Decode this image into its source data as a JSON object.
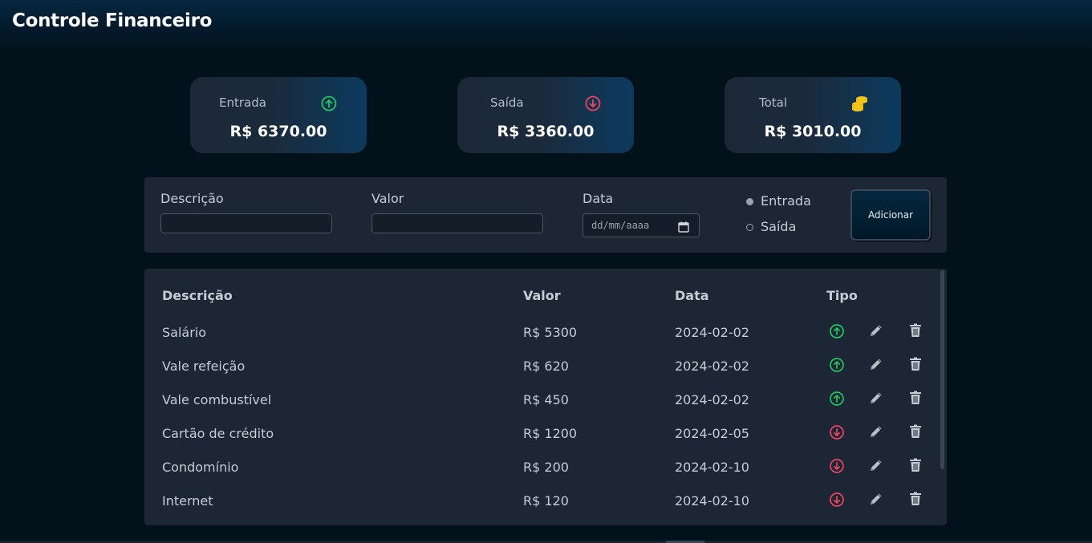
{
  "app": {
    "title": "Controle Financeiro"
  },
  "summary": {
    "income": {
      "label": "Entrada",
      "value": "R$ 6370.00",
      "icon": "arrow-up-circle-icon",
      "color": "#22c55e"
    },
    "expense": {
      "label": "Saída",
      "value": "R$ 3360.00",
      "icon": "arrow-down-circle-icon",
      "color": "#ef4460"
    },
    "total": {
      "label": "Total",
      "value": "R$ 3010.00",
      "icon": "coins-icon",
      "color": "#f5c518"
    }
  },
  "form": {
    "description_label": "Descrição",
    "description_value": "",
    "amount_label": "Valor",
    "amount_value": "",
    "date_label": "Data",
    "date_placeholder": "dd/mm/aaaa",
    "type_options": [
      {
        "label": "Entrada",
        "checked": true
      },
      {
        "label": "Saída",
        "checked": false
      }
    ],
    "add_button": "Adicionar"
  },
  "table": {
    "headers": {
      "description": "Descrição",
      "amount": "Valor",
      "date": "Data",
      "type": "Tipo"
    },
    "rows": [
      {
        "description": "Salário",
        "amount": "R$ 5300",
        "date": "2024-02-02",
        "type": "entrada"
      },
      {
        "description": "Vale refeição",
        "amount": "R$ 620",
        "date": "2024-02-02",
        "type": "entrada"
      },
      {
        "description": "Vale combustível",
        "amount": "R$ 450",
        "date": "2024-02-02",
        "type": "entrada"
      },
      {
        "description": "Cartão de crédito",
        "amount": "R$ 1200",
        "date": "2024-02-05",
        "type": "saida"
      },
      {
        "description": "Condomínio",
        "amount": "R$ 200",
        "date": "2024-02-10",
        "type": "saida"
      },
      {
        "description": "Internet",
        "amount": "R$ 120",
        "date": "2024-02-10",
        "type": "saida"
      }
    ],
    "row_icons": {
      "edit": "pencil-icon",
      "delete": "trash-icon"
    }
  },
  "colors": {
    "background": "#03121a",
    "panel": "#1c2634",
    "income": "#22c55e",
    "expense": "#ef4460",
    "icon_gray": "#9aa3ad"
  }
}
